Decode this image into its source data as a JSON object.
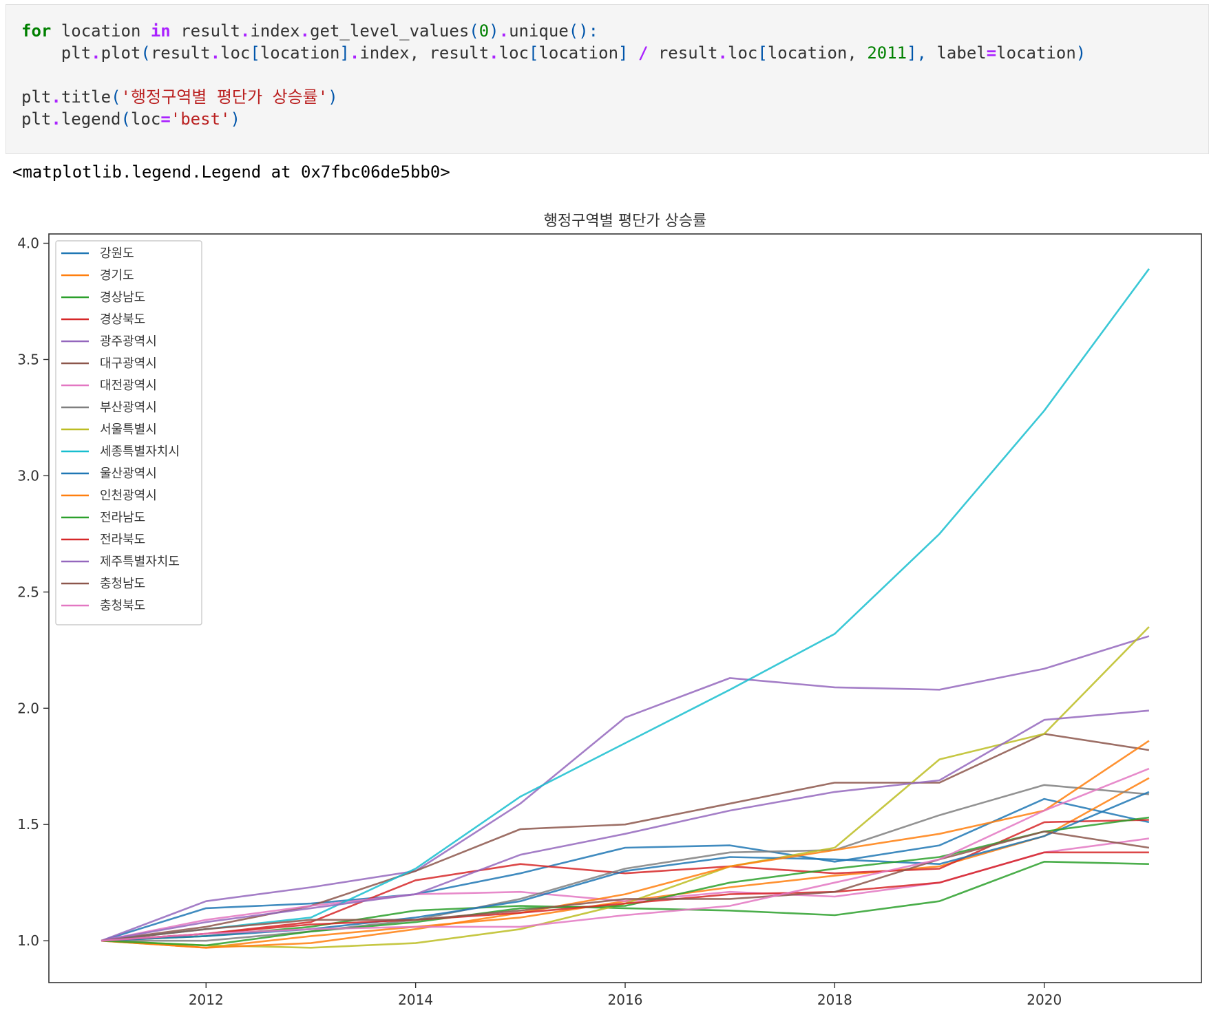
{
  "code": {
    "line1": {
      "kw_for": "for",
      "var": " location ",
      "kw_in": "in",
      "rest1": " result",
      "dot1": ".",
      "rest2": "index",
      "dot2": ".",
      "rest3": "get_level_values",
      "p1": "(",
      "n0": "0",
      "p2": ")",
      "dot3": ".",
      "rest4": "unique",
      "p3": "():"
    },
    "line2": {
      "indent": "    plt",
      "dot1": ".",
      "a": "plot",
      "p1": "(",
      "b": "result",
      "dot2": ".",
      "c": "loc",
      "p2": "[",
      "d": "location",
      "p3": "]",
      "dot3": ".",
      "e": "index, result",
      "dot4": ".",
      "f": "loc",
      "p4": "[",
      "g": "location",
      "p5": "]",
      "sp1": " ",
      "op": "/",
      "h": " result",
      "dot5": ".",
      "i": "loc",
      "p6": "[",
      "j": "location, ",
      "n2011": "2011",
      "p7": "],",
      "k": " label",
      "eq": "=",
      "l": "location",
      "p8": ")"
    },
    "line4": {
      "a": "plt",
      "dot": ".",
      "b": "title",
      "p1": "(",
      "s": "'행정구역별 평단가 상승률'",
      "p2": ")"
    },
    "line5": {
      "a": "plt",
      "dot": ".",
      "b": "legend",
      "p1": "(",
      "c": "loc",
      "eq": "=",
      "s": "'best'",
      "p2": ")"
    }
  },
  "output_text": "<matplotlib.legend.Legend at 0x7fbc06de5bb0>",
  "chart_data": {
    "type": "line",
    "title": "행정구역별 평단가 상승률",
    "xlabel": "",
    "ylabel": "",
    "x": [
      2011,
      2012,
      2013,
      2014,
      2015,
      2016,
      2017,
      2018,
      2019,
      2020,
      2021
    ],
    "xlim": [
      2010.5,
      2021.5
    ],
    "ylim": [
      0.82,
      4.04
    ],
    "xticks": [
      "2012",
      "2014",
      "2016",
      "2018",
      "2020"
    ],
    "yticks": [
      "1.0",
      "1.5",
      "2.0",
      "2.5",
      "3.0",
      "3.5",
      "4.0"
    ],
    "grid": false,
    "legend_position": "top-left",
    "series": [
      {
        "name": "강원도",
        "color": "#1f77b4",
        "values": [
          1.0,
          1.14,
          1.16,
          1.2,
          1.29,
          1.4,
          1.41,
          1.34,
          1.41,
          1.61,
          1.51
        ]
      },
      {
        "name": "경기도",
        "color": "#ff7f0e",
        "values": [
          1.0,
          0.97,
          1.02,
          1.06,
          1.1,
          1.17,
          1.23,
          1.28,
          1.32,
          1.45,
          1.7
        ]
      },
      {
        "name": "경상남도",
        "color": "#2ca02c",
        "values": [
          1.0,
          1.02,
          1.06,
          1.13,
          1.15,
          1.14,
          1.13,
          1.11,
          1.17,
          1.34,
          1.33
        ]
      },
      {
        "name": "경상북도",
        "color": "#d62728",
        "values": [
          1.0,
          1.03,
          1.08,
          1.26,
          1.33,
          1.29,
          1.32,
          1.29,
          1.31,
          1.51,
          1.52
        ]
      },
      {
        "name": "광주광역시",
        "color": "#9467bd",
        "values": [
          1.0,
          1.17,
          1.23,
          1.3,
          1.59,
          1.96,
          2.13,
          2.09,
          2.08,
          2.17,
          2.31
        ]
      },
      {
        "name": "대구광역시",
        "color": "#8c564b",
        "values": [
          1.0,
          1.06,
          1.15,
          1.3,
          1.48,
          1.5,
          1.59,
          1.68,
          1.68,
          1.89,
          1.82
        ]
      },
      {
        "name": "대전광역시",
        "color": "#e377c2",
        "values": [
          1.0,
          1.09,
          1.15,
          1.2,
          1.21,
          1.17,
          1.21,
          1.19,
          1.25,
          1.38,
          1.44
        ]
      },
      {
        "name": "부산광역시",
        "color": "#7f7f7f",
        "values": [
          1.0,
          1.0,
          1.04,
          1.09,
          1.18,
          1.31,
          1.38,
          1.39,
          1.54,
          1.67,
          1.63
        ]
      },
      {
        "name": "서울특별시",
        "color": "#bcbd22",
        "values": [
          1.0,
          0.98,
          0.97,
          0.99,
          1.05,
          1.16,
          1.32,
          1.4,
          1.78,
          1.89,
          2.35
        ]
      },
      {
        "name": "세종특별자치시",
        "color": "#17becf",
        "values": [
          1.0,
          1.05,
          1.1,
          1.31,
          1.62,
          1.85,
          2.08,
          2.32,
          2.75,
          3.28,
          3.89
        ]
      },
      {
        "name": "울산광역시",
        "color": "#1f77b4",
        "values": [
          1.0,
          1.02,
          1.05,
          1.1,
          1.17,
          1.3,
          1.36,
          1.35,
          1.33,
          1.45,
          1.64
        ]
      },
      {
        "name": "인천광역시",
        "color": "#ff7f0e",
        "values": [
          1.0,
          0.97,
          0.99,
          1.05,
          1.12,
          1.2,
          1.32,
          1.39,
          1.46,
          1.56,
          1.86
        ]
      },
      {
        "name": "전라남도",
        "color": "#2ca02c",
        "values": [
          1.0,
          0.98,
          1.04,
          1.08,
          1.14,
          1.15,
          1.25,
          1.31,
          1.36,
          1.47,
          1.53
        ]
      },
      {
        "name": "전라북도",
        "color": "#d62728",
        "values": [
          1.0,
          1.03,
          1.07,
          1.09,
          1.12,
          1.16,
          1.2,
          1.21,
          1.25,
          1.38,
          1.38
        ]
      },
      {
        "name": "제주특별자치도",
        "color": "#9467bd",
        "values": [
          1.0,
          1.08,
          1.14,
          1.2,
          1.37,
          1.46,
          1.56,
          1.64,
          1.69,
          1.95,
          1.99
        ]
      },
      {
        "name": "충청남도",
        "color": "#8c564b",
        "values": [
          1.0,
          1.05,
          1.09,
          1.09,
          1.13,
          1.18,
          1.18,
          1.21,
          1.35,
          1.47,
          1.4
        ]
      },
      {
        "name": "충청북도",
        "color": "#e377c2",
        "values": [
          1.0,
          1.03,
          1.05,
          1.06,
          1.06,
          1.11,
          1.15,
          1.25,
          1.35,
          1.56,
          1.74
        ]
      }
    ]
  }
}
